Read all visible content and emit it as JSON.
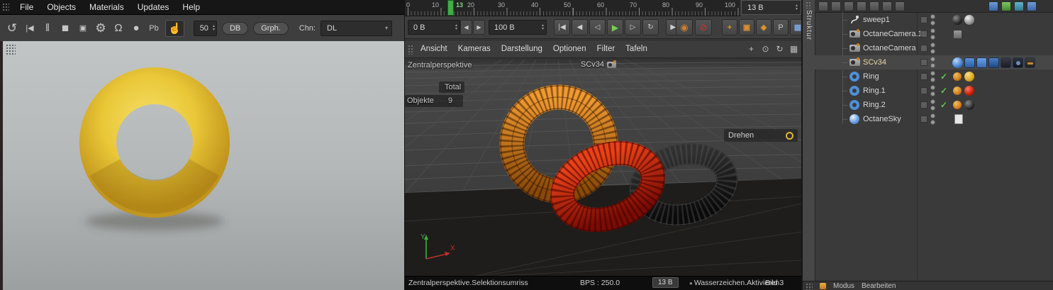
{
  "menubar": {
    "items": [
      "File",
      "Objects",
      "Materials",
      "Updates",
      "Help"
    ]
  },
  "toolbar": {
    "frame_value": "50",
    "db_button": "DB",
    "graph_button": "Grph.",
    "channel_label": "Chn:",
    "channel_value": "DL"
  },
  "timeline": {
    "ticks": [
      "0",
      "10",
      "20",
      "30",
      "40",
      "50",
      "60",
      "70",
      "80",
      "90",
      "100"
    ],
    "current_frame": "13",
    "frame_field": "13 B",
    "range_start": "0 B",
    "range_end": "100 B"
  },
  "viewport": {
    "menu": [
      "Ansicht",
      "Kameras",
      "Darstellung",
      "Optionen",
      "Filter",
      "Tafeln"
    ],
    "camera_label": "Zentralperspektive",
    "scene_camera": "SCv34",
    "hud_total_label": "Total",
    "hud_objects_label": "Objekte",
    "hud_objects_value": "9",
    "tool_hint": "Drehen",
    "axis_x": "X",
    "axis_y": "Y",
    "status_selection": "Zentralperspektive.Selektionsumriss",
    "status_bps": "BPS : 250.0",
    "status_frame": "13 B",
    "status_watermark": "Wasserzeichen.Aktivieren",
    "status_image": "Bild 3"
  },
  "object_manager": {
    "tab_label": "Struktur",
    "objects": [
      {
        "name": "sweep1",
        "type": "sweep"
      },
      {
        "name": "OctaneCamera.1",
        "type": "camera"
      },
      {
        "name": "OctaneCamera",
        "type": "camera"
      },
      {
        "name": "SCv34",
        "type": "camera"
      },
      {
        "name": "Ring",
        "type": "torus",
        "material_color": "#d8a820"
      },
      {
        "name": "Ring.1",
        "type": "torus",
        "material_color": "#c81c08"
      },
      {
        "name": "Ring.2",
        "type": "torus",
        "material_color": "#2c2c2c"
      },
      {
        "name": "OctaneSky",
        "type": "sky"
      }
    ]
  },
  "attribute_bar": {
    "mode_label": "Modus",
    "edit_label": "Bearbeiten"
  },
  "scene": {
    "render_ring_color": "#e9c737",
    "viewport_rings": [
      {
        "name": "orange",
        "color": "#d9831f"
      },
      {
        "name": "red",
        "color": "#c41808"
      },
      {
        "name": "black",
        "color": "#161616"
      }
    ]
  },
  "colors": {
    "play_green": "#6fd24f",
    "marker_green": "#3fae46",
    "check_green": "#5cc84e",
    "accent_orange": "#d08030",
    "torus_icon_blue": "#4f8fd8"
  },
  "icons": {
    "refresh": "↺",
    "skip_start": "|◀",
    "pause": "‖",
    "stop": "■",
    "res": "▣",
    "gear": "⚙",
    "magnet": "Ω",
    "sphere": "●",
    "pb": "Pb",
    "hand": "☝",
    "up": "▴",
    "down": "▾",
    "left": "◀",
    "right": "▶",
    "t_start": "|◀",
    "t_rew": "◀",
    "t_back": "◁",
    "t_play": "▶",
    "t_fwd": "▷",
    "t_loop": "↻",
    "t_end": "▶|",
    "rec_region": "◉",
    "rec_lock": "⊘",
    "key_pos": "+",
    "key_scale": "▣",
    "key_rot": "◆",
    "key_p": "P",
    "key_grid": "▦",
    "vp_pan": "+",
    "vp_zoom": "⊙",
    "vp_rot": "↻",
    "vp_layout": "▦",
    "check": "✓",
    "dot": "●"
  }
}
